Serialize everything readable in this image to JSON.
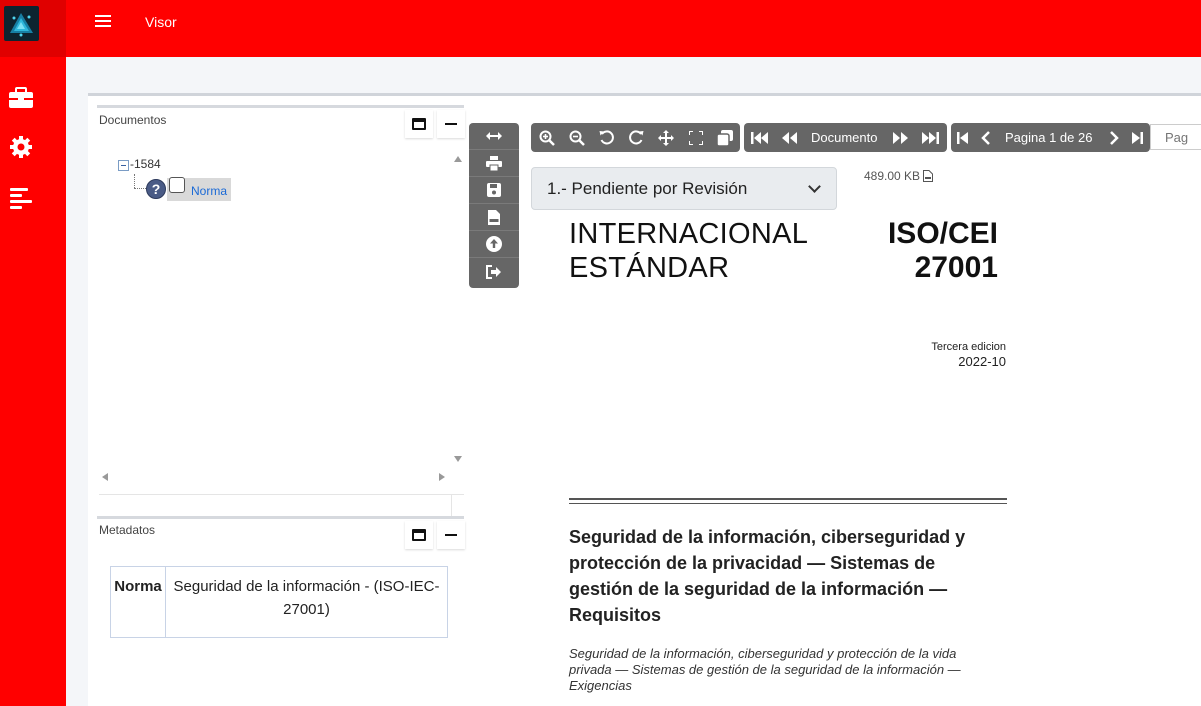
{
  "header": {
    "title": "Visor",
    "menu_icon": "hamburger-icon"
  },
  "sidebar": {
    "items": [
      {
        "name": "briefcase-icon"
      },
      {
        "name": "gear-icon"
      },
      {
        "name": "align-left-icon"
      }
    ]
  },
  "documents_panel": {
    "title": "Documentos",
    "tree": {
      "root_label": "1584",
      "child_label": "Norma",
      "help_glyph": "?"
    }
  },
  "metadata_panel": {
    "title": "Metadatos",
    "rows": [
      {
        "key": "Norma",
        "value": "Seguridad de la información - (ISO-IEC-27001)"
      }
    ]
  },
  "viewer": {
    "document_label": "Documento",
    "page_label": "Pagina 1 de 26",
    "page_input_placeholder": "Pag",
    "status_selected": "1.- Pendiente por Revisión",
    "file_size": "489.00 KB"
  },
  "document_page": {
    "title_left_line1": "INTERNACIONAL",
    "title_left_line2": "ESTÁNDAR",
    "title_right_line1": "ISO/CEI",
    "title_right_line2": "27001",
    "edition": "Tercera edicion",
    "year": "2022-10",
    "heading": "Seguridad de la información, ciberseguridad y protección de la privacidad — Sistemas de gestión de la seguridad de la información — Requisitos",
    "subheading": "Seguridad de la información, ciberseguridad y protección de la vida privada — Sistemas de gestión de la seguridad de la información — Exigencias"
  },
  "colors": {
    "brand": "#ff0000",
    "toolbar": "#666666",
    "link": "#1b6ad6"
  }
}
